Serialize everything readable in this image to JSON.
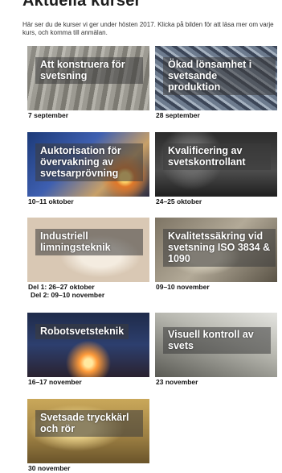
{
  "page": {
    "title": "Aktuella kurser",
    "intro": "Här ser du de kurser vi ger under hösten 2017. Klicka på bilden för att läsa mer om varje kurs, och komma till anmälan."
  },
  "courses": [
    {
      "title": "Att konstruera för svetsning",
      "date": "7 september"
    },
    {
      "title": "Ökad lönsamhet i svetsande produktion",
      "date": "28 september"
    },
    {
      "title": "Auktorisation för övervakning av svetsarprövning",
      "date": "10–11 oktober"
    },
    {
      "title": "Kvalificering av svetskontrollant",
      "date": "24–25 oktober"
    },
    {
      "title": "Industriell limningsteknik",
      "date": "Del 1: 26–27 oktober",
      "date2": "Del 2: 09–10 november"
    },
    {
      "title": "Kvalitetssäkring vid svetsning ISO 3834 & 1090",
      "date": "09–10 november"
    },
    {
      "title": "Robotsvetsteknik",
      "date": "16–17 november"
    },
    {
      "title": "Visuell kontroll av svets",
      "date": "23 november"
    },
    {
      "title": "Svetsade tryckkärl och rör",
      "date": "30 november"
    }
  ]
}
